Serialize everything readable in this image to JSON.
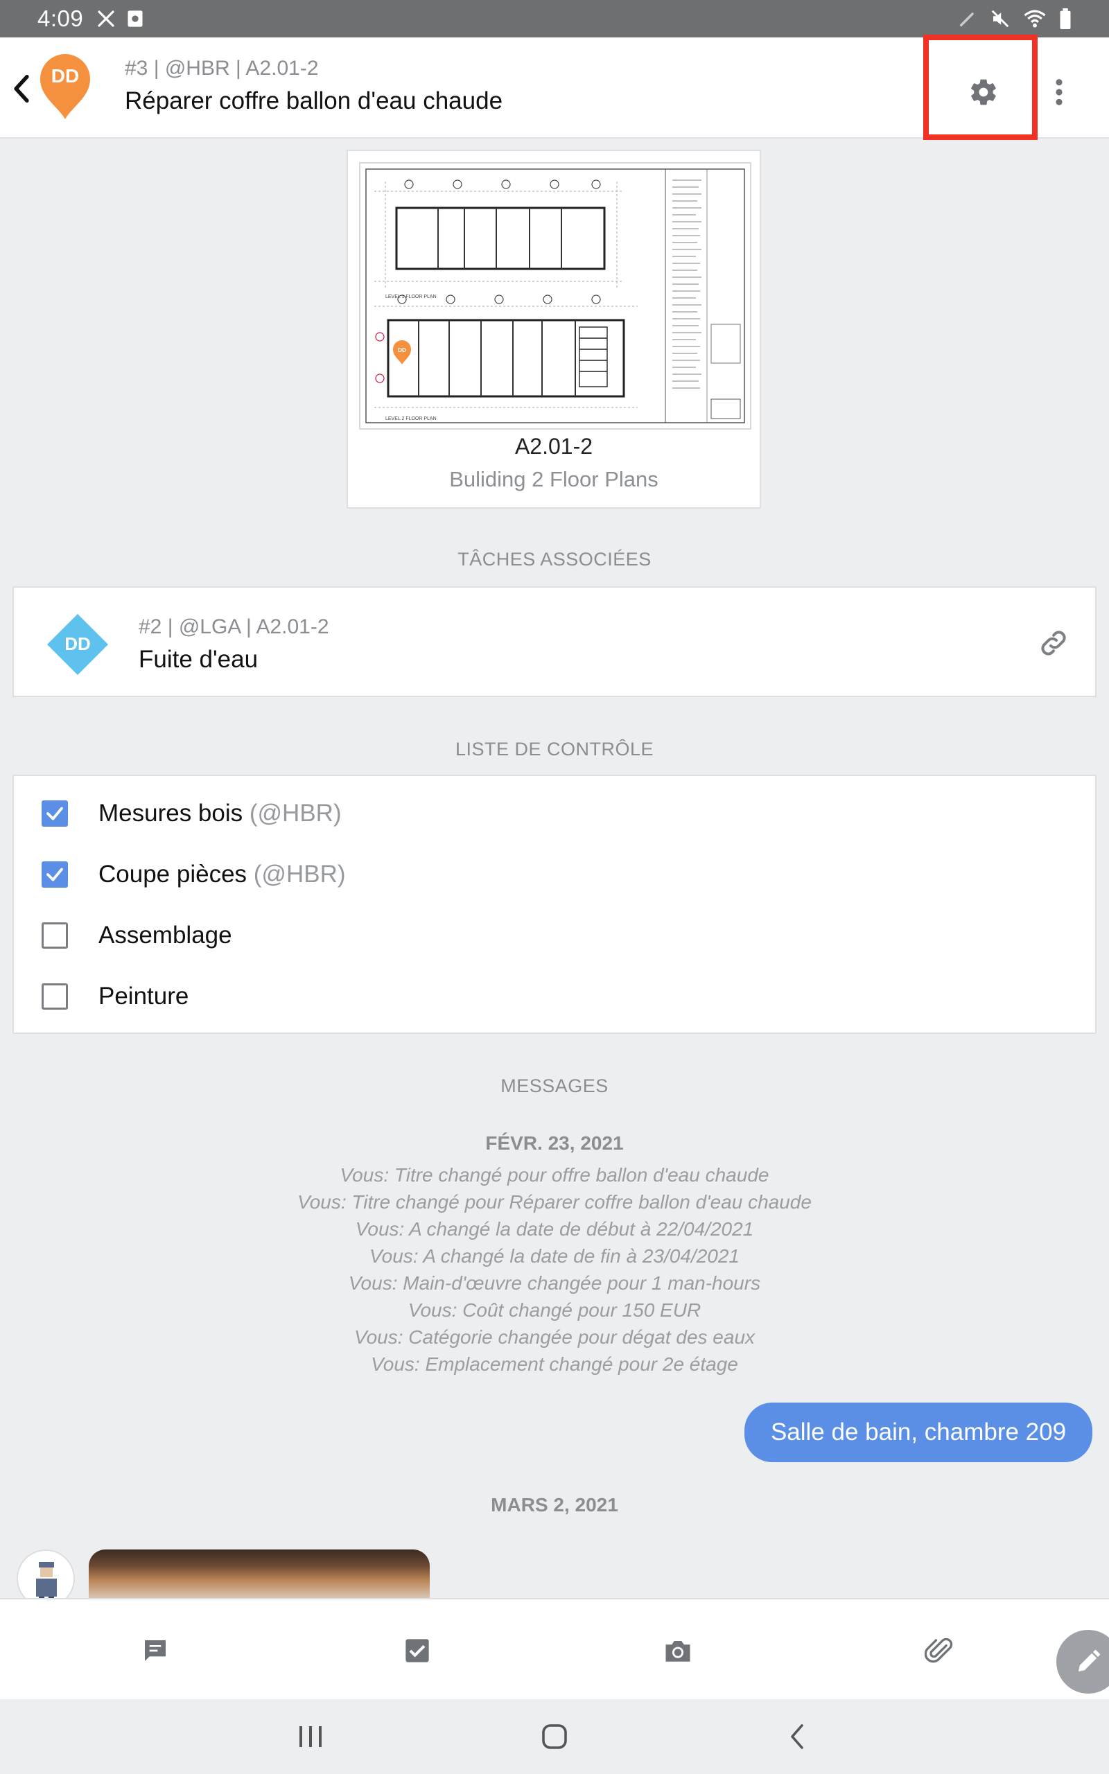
{
  "status_bar": {
    "time": "4:09"
  },
  "header": {
    "avatar_initials": "DD",
    "meta": "#3 | @HBR | A2.01-2",
    "title": "Réparer coffre ballon d'eau chaude"
  },
  "plan": {
    "name": "A2.01-2",
    "description": "Buliding 2 Floor Plans",
    "pin_initials": "DD"
  },
  "related_tasks": {
    "label": "TÂCHES ASSOCIÉES",
    "items": [
      {
        "avatar_initials": "DD",
        "meta": "#2 | @LGA | A2.01-2",
        "title": "Fuite d'eau"
      }
    ]
  },
  "checklist": {
    "label": "LISTE DE CONTRÔLE",
    "items": [
      {
        "label": "Mesures bois",
        "owner": "(@HBR)",
        "checked": true
      },
      {
        "label": "Coupe pièces",
        "owner": "(@HBR)",
        "checked": true
      },
      {
        "label": "Assemblage",
        "owner": "",
        "checked": false
      },
      {
        "label": "Peinture",
        "owner": "",
        "checked": false
      }
    ]
  },
  "messages": {
    "label": "MESSAGES",
    "groups": [
      {
        "date": "FÉVR. 23, 2021",
        "log": [
          "Vous: Titre changé pour offre ballon d'eau chaude",
          "Vous: Titre changé pour Réparer coffre ballon d'eau chaude",
          "Vous: A changé la date de début à 22/04/2021",
          "Vous: A changé la date de fin à 23/04/2021",
          "Vous: Main-d'œuvre changée pour 1 man-hours",
          "Vous: Coût changé pour 150 EUR",
          "Vous: Catégorie changée pour dégat des eaux",
          "Vous: Emplacement changé pour 2e étage"
        ],
        "bubble": "Salle de bain, chambre 209"
      },
      {
        "date": "MARS 2, 2021"
      }
    ]
  },
  "colors": {
    "accent": "#5b8fe6",
    "pin": "#f5913e",
    "diamond": "#5ec1ee",
    "highlight": "#f03124"
  },
  "icons": {
    "toolbar": [
      "message-icon",
      "checkbox-icon",
      "camera-icon",
      "paperclip-icon"
    ],
    "fab": "pencil-icon"
  }
}
